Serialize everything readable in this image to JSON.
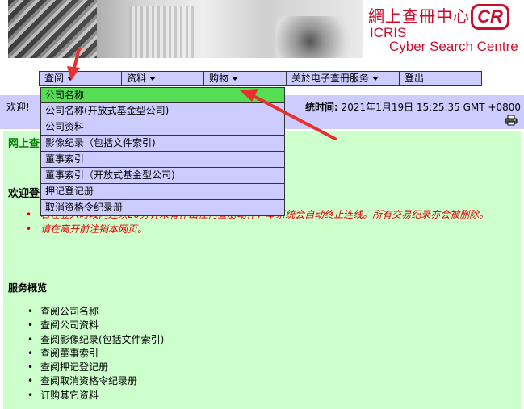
{
  "header": {
    "logo_cn": "網上查冊中心",
    "logo_badge": "CR",
    "logo_en_1": "ICRIS",
    "logo_en_2": "Cyber Search Centre"
  },
  "menubar": {
    "items": [
      {
        "label": "查阅",
        "has_caret": true
      },
      {
        "label": "资料",
        "has_caret": true
      },
      {
        "label": "购物",
        "has_caret": true
      },
      {
        "label": "关於电子查冊服务",
        "has_caret": true
      },
      {
        "label": "登出",
        "has_caret": false
      }
    ]
  },
  "dropdown": {
    "items": [
      {
        "label": "公司名称",
        "highlighted": true
      },
      {
        "label": "公司名称(开放式基金型公司)"
      },
      {
        "label": "公司资料"
      },
      {
        "label": "影像纪录（包括文件索引)"
      },
      {
        "label": "董事索引"
      },
      {
        "label": "董事索引（开放式基金型公司)"
      },
      {
        "label": "押记登记册"
      },
      {
        "label": "取消资格令纪录册"
      }
    ]
  },
  "welcome_bar": {
    "welcome_text": "欢迎!",
    "login_label": "统时间:",
    "login_time": "2021年1月19日 15:25:35 GMT +0800"
  },
  "content": {
    "green_title": "网上查",
    "welcome_title": "欢迎登",
    "notices": [
      "若在登入时段内连续20分钟未有作出任何查册动作，本系统会自动终止连线。所有交易纪录亦会被删除。",
      "请在离开前注销本网页。"
    ],
    "services_title": "服务概览",
    "services": [
      "查阅公司名称",
      "查阅公司资料",
      "查阅影像纪录(包括文件索引)",
      "查阅董事索引",
      "查阅押记登记册",
      "查阅取消资格令纪录册",
      "订购其它资料"
    ]
  },
  "colors": {
    "menu_bg": "#ccccff",
    "highlight": "#55dd55",
    "content_bg": "#ccffcc",
    "brand_red": "#c8102e",
    "annotation_arrow": "#e8312f"
  },
  "icons": {
    "print": "printer-icon",
    "caret": "caret-down-icon"
  }
}
